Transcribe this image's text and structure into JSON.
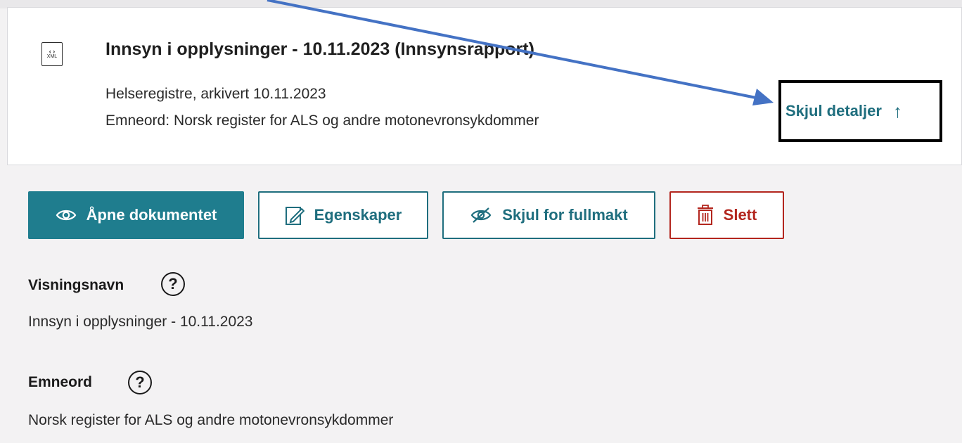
{
  "document": {
    "icon_code": "‹ ›",
    "icon_label": "XML",
    "title": "Innsyn i opplysninger - 10.11.2023 (Innsynsrapport)",
    "archive_info": "Helseregistre, arkivert 10.11.2023",
    "keywords_prefix": "Emneord:",
    "keywords_value": "Norsk register for ALS og andre motonevronsykdommer",
    "toggle_label": "Skjul detaljer",
    "toggle_arrow": "↑"
  },
  "actions": {
    "open_label": "Åpne dokumentet",
    "properties_label": "Egenskaper",
    "hide_label": "Skjul for fullmakt",
    "delete_label": "Slett"
  },
  "details": {
    "display_name_label": "Visningsnavn",
    "display_name_value": "Innsyn i opplysninger - 10.11.2023",
    "keywords_label": "Emneord",
    "keywords_value": "Norsk register for ALS og andre motonevronsykdommer",
    "help_glyph": "?"
  },
  "colors": {
    "accent": "#1f7d8e",
    "accent_text": "#1f6e7e",
    "danger": "#b3261e",
    "annotation_arrow": "#4472c4"
  },
  "icons": [
    "xml-file-icon",
    "chevron-up-icon",
    "eye-icon",
    "edit-icon",
    "eye-slash-icon",
    "trash-icon",
    "help-icon"
  ]
}
